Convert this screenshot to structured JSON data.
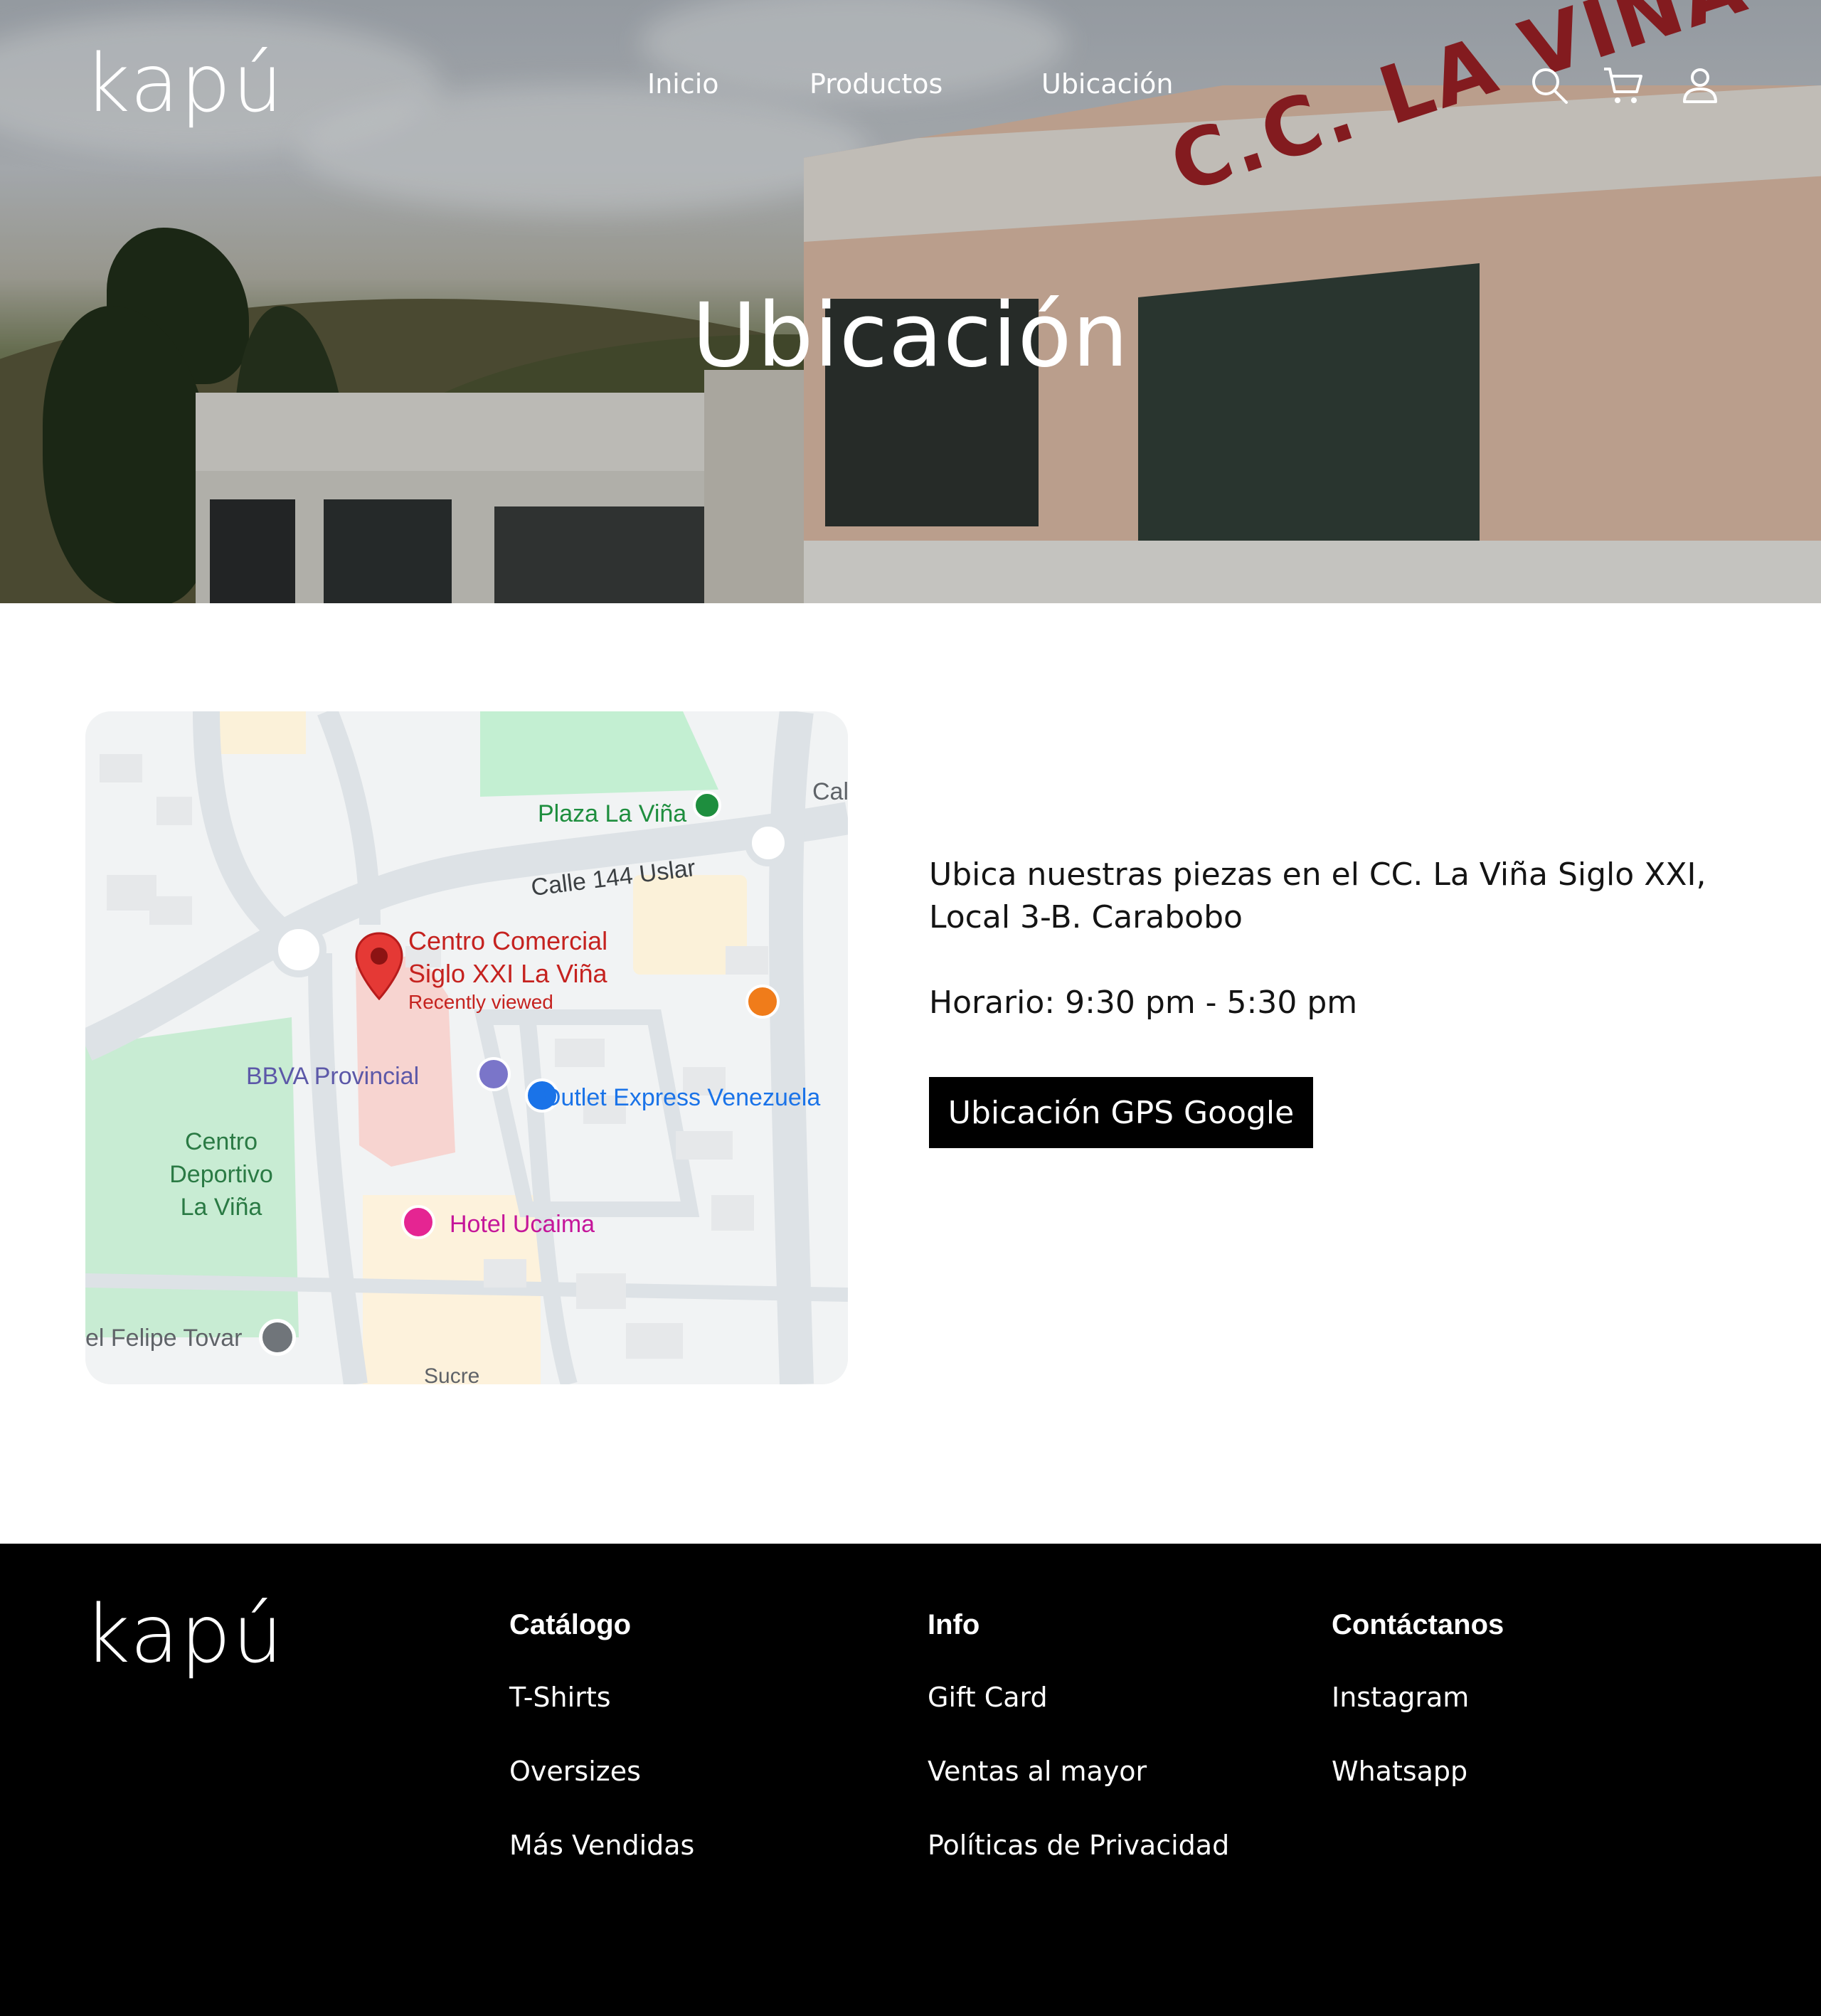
{
  "brand": {
    "logo_text": "kapú"
  },
  "nav": {
    "items": [
      "Inicio",
      "Productos",
      "Ubicación"
    ]
  },
  "header_icons": [
    "search-icon",
    "cart-icon",
    "user-icon"
  ],
  "hero": {
    "title": "Ubicación",
    "sign_text": "C.C. LA VIÑA"
  },
  "map": {
    "labels": {
      "plaza": "Plaza La Viña",
      "street": "Calle 144 Uslar",
      "street_edge": "Cal",
      "mall_line1": "Centro Comercial",
      "mall_line2": "Siglo XXI La Viña",
      "mall_note": "Recently viewed",
      "bank": "BBVA Provincial",
      "outlet": "Outlet Express Venezuela",
      "sport_line1": "Centro",
      "sport_line2": "Deportivo",
      "sport_line3": "La Viña",
      "hotel": "Hotel Ucaima",
      "felipe": "el Felipe Tovar",
      "bottom_street": "Sucre"
    }
  },
  "info": {
    "address": "Ubica nuestras piezas en el CC. La Viña Siglo XXI, Local 3-B. Carabobo",
    "hours": "Horario: 9:30 pm - 5:30 pm",
    "gps_button": "Ubicación GPS Google"
  },
  "footer": {
    "columns": [
      {
        "title": "Catálogo",
        "links": [
          "T-Shirts",
          "Oversizes",
          "Más Vendidas"
        ]
      },
      {
        "title": "Info",
        "links": [
          "Gift Card",
          "Ventas al mayor",
          "Políticas de Privacidad"
        ]
      },
      {
        "title": "Contáctanos",
        "links": [
          "Instagram",
          "Whatsapp"
        ]
      }
    ]
  },
  "colors": {
    "footer_bg": "#000000",
    "button_bg": "#000000",
    "text": "#141414"
  }
}
